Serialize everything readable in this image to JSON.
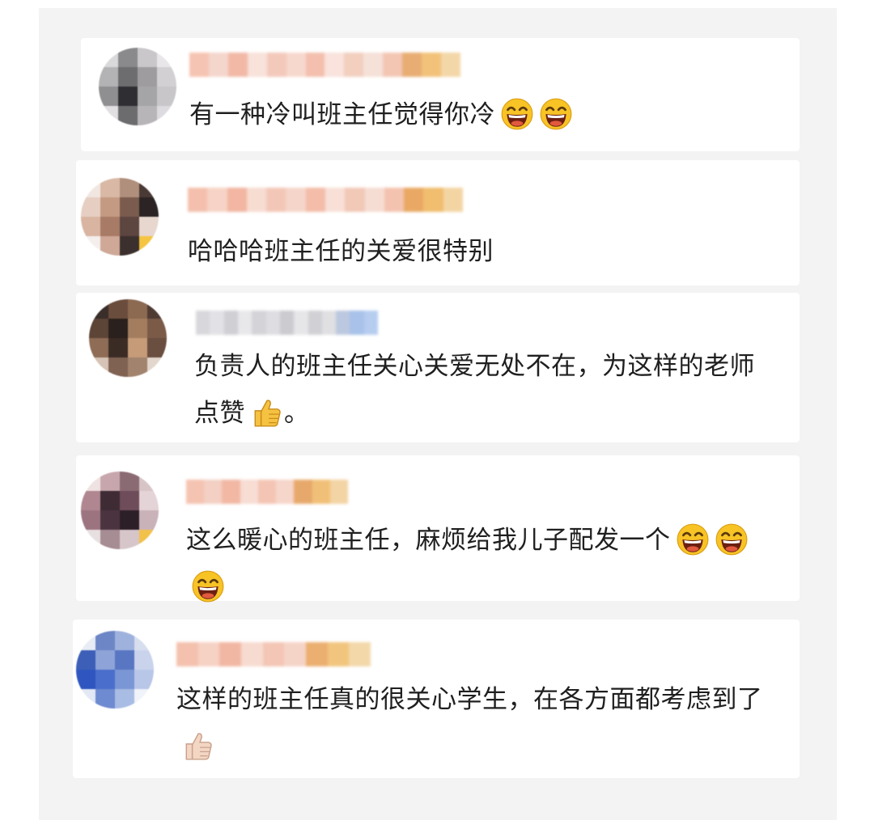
{
  "comments": [
    {
      "text": "有一种冷叫班主任觉得你冷",
      "emojis": [
        "grinning-face-icon",
        "grinning-face-icon"
      ],
      "avatar_colors": [
        "#d9d9db",
        "#8a8a8c",
        "#c9c7c9",
        "#e8e6e8",
        "#b3b2b5",
        "#6d6d70",
        "#9e9c9f",
        "#d2d0d3",
        "#8f8e91",
        "#2f2f33",
        "#a5a4a7",
        "#c8c6c9",
        "#e1dfe2",
        "#6c6b6e",
        "#b7b5b8",
        "#dddbe0"
      ],
      "name_colors": [
        "#f6c4b2",
        "#f4d6cc",
        "#f2b9a6",
        "#f8e2da",
        "#f3c9bb",
        "#f6d8cd",
        "#f4bfae",
        "#f9e3dc",
        "#f2cfbf",
        "#f5e1d8",
        "#f3c6b4",
        "#e8ad73",
        "#f2c27a",
        "#f3d7a8"
      ]
    },
    {
      "text": "哈哈哈班主任的关爱很特别",
      "emojis": [],
      "avatar_colors": [
        "#f1e7e0",
        "#d9b9a6",
        "#b08f7c",
        "#4a3a35",
        "#e6cfc2",
        "#c59a83",
        "#7a5b4e",
        "#2c2424",
        "#d8b4a1",
        "#a87b66",
        "#5d4540",
        "#e8d7cf",
        "#f4efec",
        "#cfa898",
        "#3b302e",
        "#f5c542"
      ],
      "name_colors": [
        "#f4c0ad",
        "#f6d3c6",
        "#f2b6a2",
        "#f7dcd1",
        "#f3c7b7",
        "#f5d5c9",
        "#f3bda9",
        "#f8e0d7",
        "#f2c8b6",
        "#f6ddd3",
        "#f4c3b0",
        "#e9a964",
        "#f1bd6f",
        "#f3d5a3"
      ]
    },
    {
      "text": "负责人的班主任关心关爱无处不在，为这样的老师点赞",
      "trailing": "。",
      "emojis": [
        "thumbs-up-icon"
      ],
      "avatar_colors": [
        "#3a2e2a",
        "#6b4d3d",
        "#8c6a52",
        "#4f3b33",
        "#5c4436",
        "#2a201d",
        "#a47d5f",
        "#7b5b48",
        "#8e6c55",
        "#3b2b25",
        "#c59b78",
        "#6a4e3f",
        "#d6c3b6",
        "#7f6252",
        "#a1836e",
        "#e3d6cc"
      ],
      "name_colors": [
        "#d8d8dc",
        "#e2e2e6",
        "#cfcfd4",
        "#e8e8eb",
        "#d4d4d8",
        "#dedee2",
        "#cbcbd0",
        "#e6e6e9",
        "#d1d1d5",
        "#e0e0e3",
        "#bcc8df",
        "#a8c2ea",
        "#b6cdf0"
      ]
    },
    {
      "text": "这么暖心的班主任，麻烦给我儿子配发一个",
      "emojis": [
        "grinning-face-icon",
        "grinning-face-icon",
        "grinning-face-icon"
      ],
      "avatar_colors": [
        "#efe2e3",
        "#c7a7ad",
        "#8b6b73",
        "#d7c4c7",
        "#b08791",
        "#3e2b33",
        "#6f4c59",
        "#e4d4d7",
        "#9c7480",
        "#4b3440",
        "#2d1f27",
        "#c9b2b8",
        "#e8dfe1",
        "#a68c93",
        "#d6c6ca",
        "#f2c14a"
      ],
      "name_colors": [
        "#f5c3b1",
        "#f3d0c3",
        "#f2b8a4",
        "#f7ddd3",
        "#f4c5b5",
        "#f6d6ca",
        "#e7a96b",
        "#f1c078",
        "#f3d4a5"
      ]
    },
    {
      "text": "这样的班主任真的很关心学生，在各方面都考虑到了",
      "emojis": [
        "thumbs-up-light-icon"
      ],
      "avatar_colors": [
        "#e7ecf5",
        "#6c86c6",
        "#9fb2de",
        "#d7deee",
        "#3d5fb7",
        "#8ea4d8",
        "#5876c2",
        "#c9d3ec",
        "#2f56c0",
        "#4a6ecb",
        "#7b96d4",
        "#b8c6e8",
        "#e2e8f4",
        "#6e8ad0",
        "#a9bce4",
        "#f0f3f9"
      ],
      "name_colors": [
        "#f4c1ae",
        "#f6d2c5",
        "#f2b7a3",
        "#f7dbd0",
        "#f3c6b6",
        "#f5d4c8",
        "#ebaf70",
        "#f2c57e",
        "#f3d8aa"
      ]
    }
  ]
}
